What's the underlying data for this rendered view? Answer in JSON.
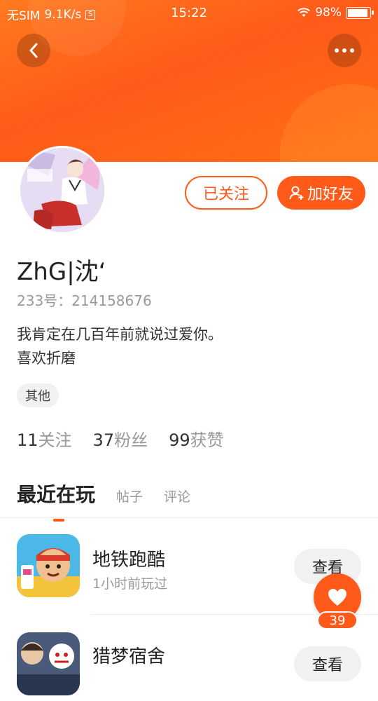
{
  "status_bar": {
    "carrier": "无SIM",
    "net_speed": "9.1K/s",
    "s_badge": "S",
    "time": "15:22",
    "battery": "98%",
    "icons": [
      "wifi-icon",
      "battery-icon"
    ]
  },
  "header": {
    "back_icon": "chevron-left-icon",
    "more_icon": "more-dots-icon"
  },
  "profile": {
    "followed_label": "已关注",
    "add_friend_label": "加好友",
    "username": "ZhG|沈‘",
    "uid": "233号：214158676",
    "bio_lines": [
      "我肯定在几百年前就说过爱你。",
      "喜欢折磨"
    ],
    "tag": "其他",
    "stats": [
      {
        "num": "11",
        "label": "关注"
      },
      {
        "num": "37",
        "label": "粉丝"
      },
      {
        "num": "99",
        "label": "获赞"
      }
    ]
  },
  "tabs": {
    "active": "最近在玩",
    "items": [
      "帖子",
      "评论"
    ]
  },
  "games": [
    {
      "name": "地铁跑酷",
      "sub": "1小时前玩过",
      "button": "查看"
    },
    {
      "name": "猎梦宿舍",
      "sub": "",
      "button": "查看"
    }
  ],
  "like": {
    "count": "39"
  },
  "colors": {
    "accent": "#ff5a1a",
    "header_gradient_end": "#ff7a1e"
  }
}
